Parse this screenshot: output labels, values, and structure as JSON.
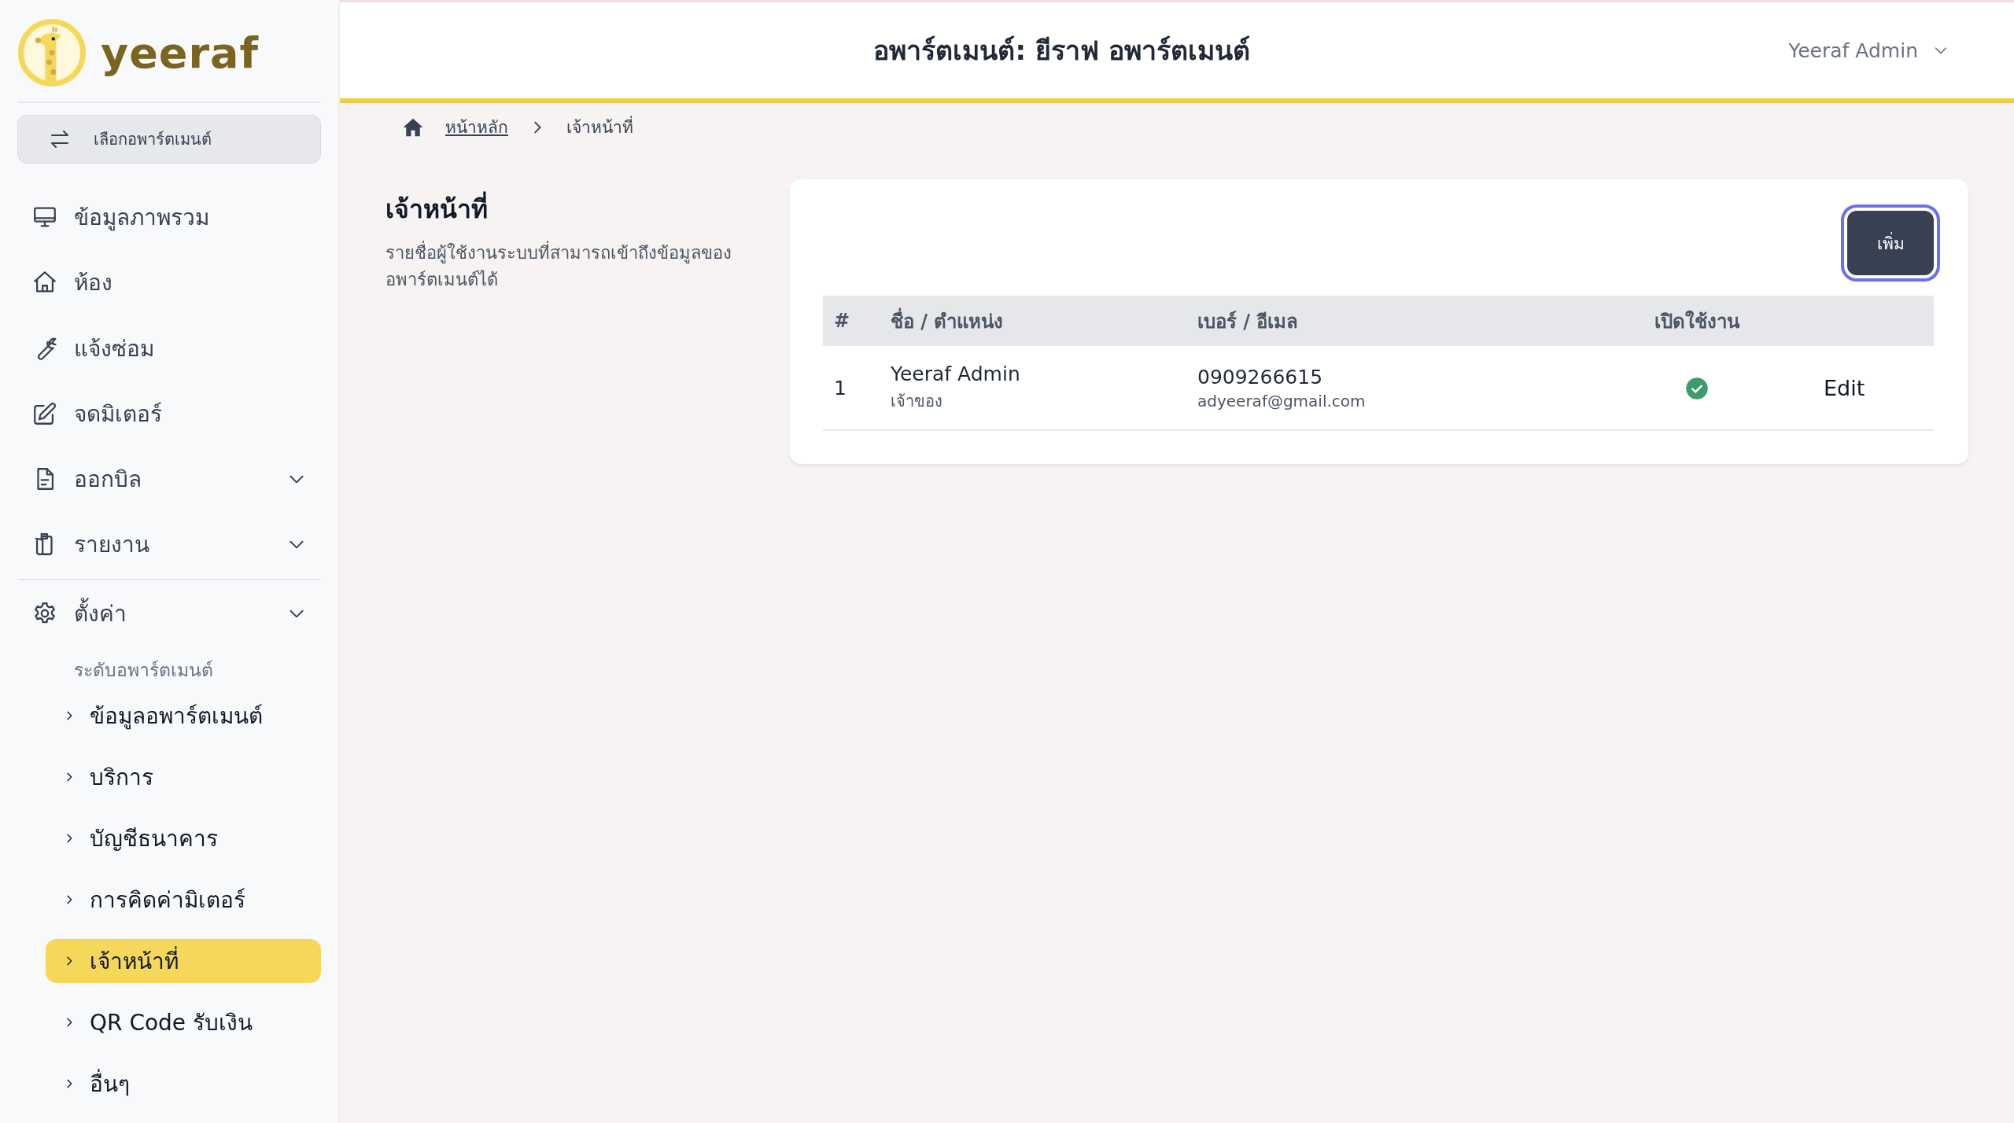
{
  "sidebar": {
    "logo_text": "yeeraf",
    "switcher": {
      "label": "เลือกอพาร์ตเมนต์"
    },
    "nav_items": [
      {
        "label": "ข้อมูลภาพรวม",
        "expandable": false
      },
      {
        "label": "ห้อง",
        "expandable": false
      },
      {
        "label": "แจ้งซ่อม",
        "expandable": false
      },
      {
        "label": "จดมิเตอร์",
        "expandable": false
      },
      {
        "label": "ออกบิล",
        "expandable": true
      },
      {
        "label": "รายงาน",
        "expandable": true
      }
    ],
    "settings": {
      "label": "ตั้งค่า",
      "expanded": true,
      "section_label": "ระดับอพาร์ตเมนต์",
      "children": [
        {
          "label": "ข้อมูลอพาร์ตเมนต์",
          "selected": false
        },
        {
          "label": "บริการ",
          "selected": false
        },
        {
          "label": "บัญชีธนาคาร",
          "selected": false
        },
        {
          "label": "การคิดค่ามิเตอร์",
          "selected": false
        },
        {
          "label": "เจ้าหน้าที่",
          "selected": true
        },
        {
          "label": "QR Code รับเงิน",
          "selected": false
        },
        {
          "label": "อื่นๆ",
          "selected": false
        }
      ]
    }
  },
  "header": {
    "title": "อพาร์ตเมนต์: ยีราฟ อพาร์ตเมนต์",
    "user": "Yeeraf Admin"
  },
  "breadcrumb": [
    {
      "label": "หน้าหลัก",
      "link": true
    },
    {
      "label": "เจ้าหน้าที่",
      "link": false
    }
  ],
  "section": {
    "title": "เจ้าหน้าที่",
    "description": "รายชื่อผู้ใช้งานระบบที่สามารถเข้าถึงข้อมูลของอพาร์ตเมนต์ได้"
  },
  "add_button": {
    "label": "เพิ่ม"
  },
  "table": {
    "columns": [
      "#",
      "ชื่อ / ตำแหน่ง",
      "เบอร์ / อีเมล",
      "เปิดใช้งาน"
    ],
    "rows": [
      {
        "number": "1",
        "name": "Yeeraf Admin",
        "role": "เจ้าของ",
        "phone": "0909266615",
        "email": "adyeeraf@gmail.com",
        "active": true,
        "action": "Edit"
      }
    ]
  }
}
